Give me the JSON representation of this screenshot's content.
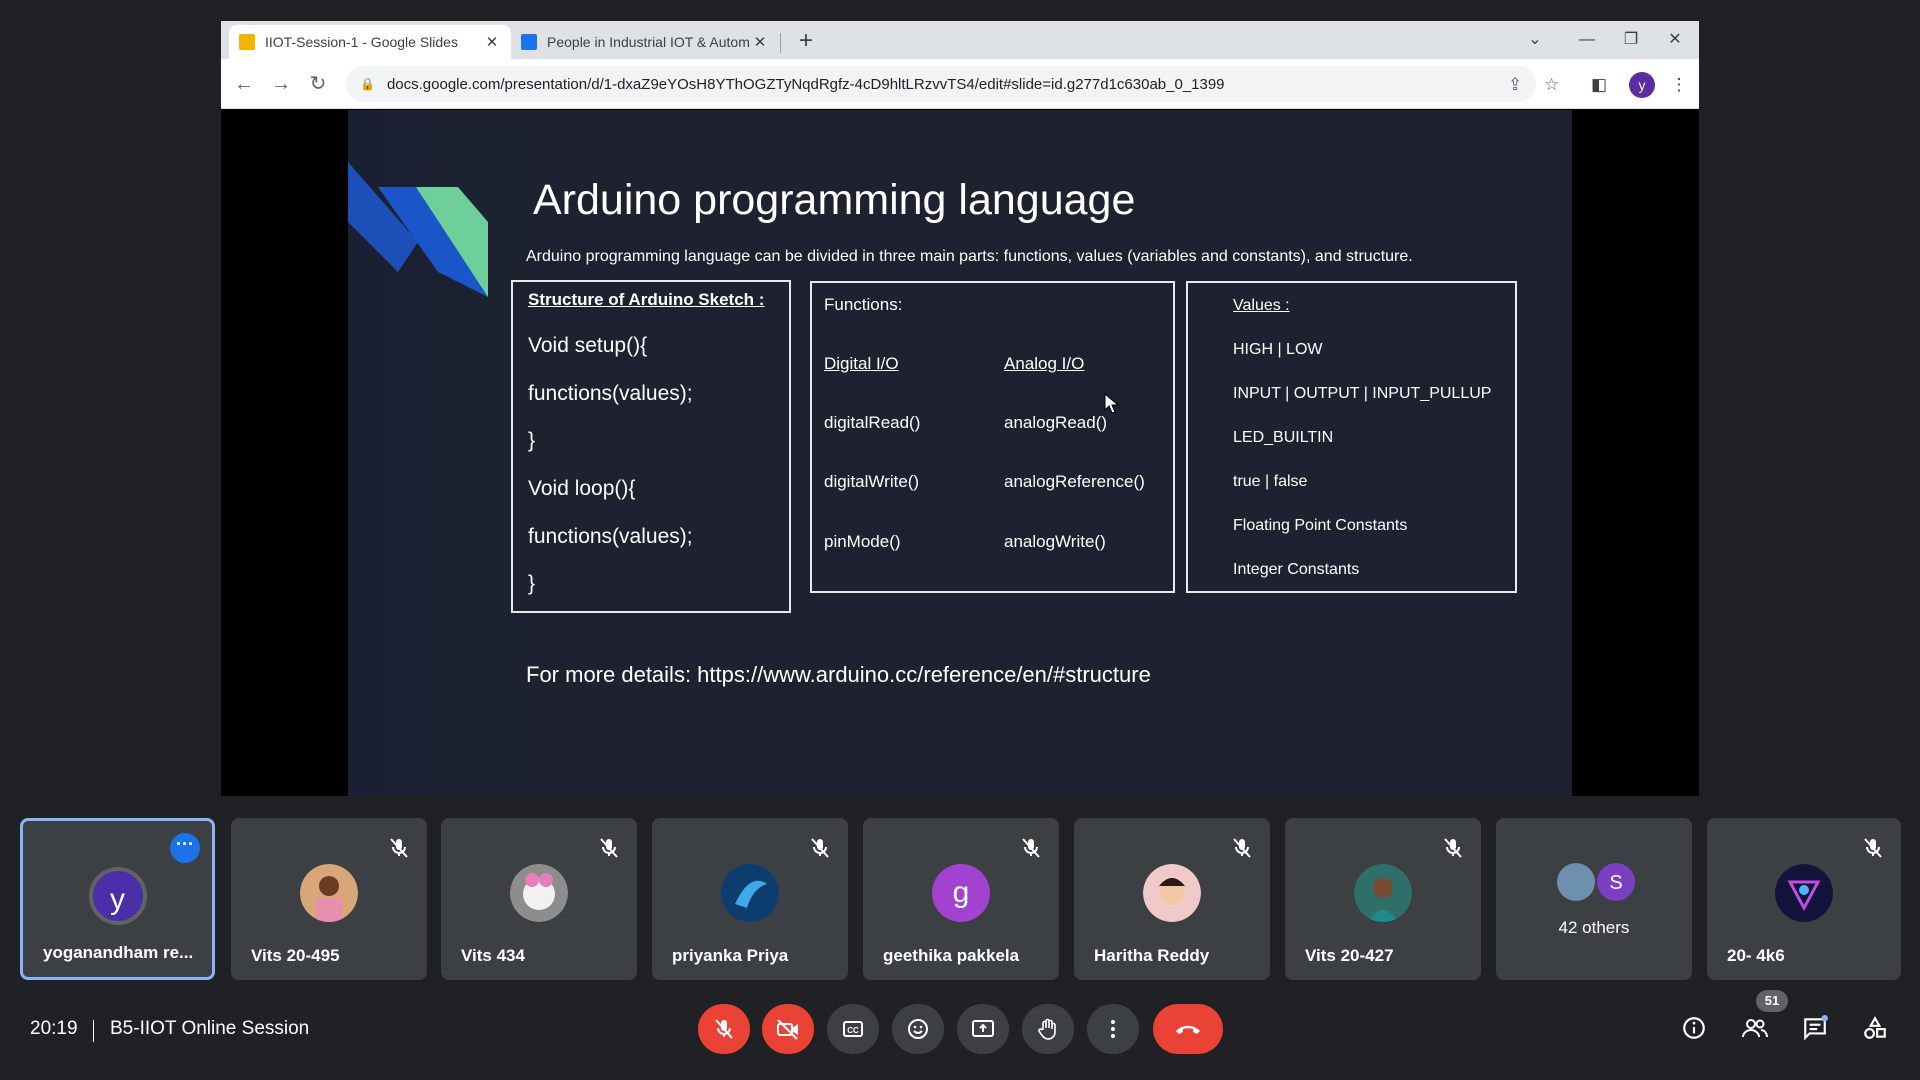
{
  "browser": {
    "tabs": [
      {
        "title": "IIOT-Session-1 - Google Slides",
        "active": true
      },
      {
        "title": "People in Industrial IOT & Autom",
        "active": false
      }
    ],
    "url": "docs.google.com/presentation/d/1-dxaZ9eYOsH8YThOGZTyNqdRgfz-4cD9hltLRzvvTS4/edit#slide=id.g277d1c630ab_0_1399",
    "profile_initial": "y"
  },
  "slide": {
    "title": "Arduino programming language",
    "subtitle": "Arduino programming language can be divided in three main parts: functions, values (variables and constants), and structure.",
    "structure": {
      "heading": "Structure of Arduino Sketch :",
      "lines": [
        "Void setup(){",
        "functions(values);",
        "}",
        "Void loop(){",
        "functions(values);",
        "}"
      ]
    },
    "functions": {
      "heading": "Functions:",
      "digital_heading": "Digital I/O",
      "analog_heading": "Analog I/O",
      "digital": [
        "digitalRead()",
        "digitalWrite()",
        "pinMode()"
      ],
      "analog": [
        "analogRead()",
        "analogReference()",
        "analogWrite()"
      ]
    },
    "values": {
      "heading": "Values :",
      "items": [
        "HIGH | LOW",
        "INPUT | OUTPUT | INPUT_PULLUP",
        "LED_BUILTIN",
        "true | false",
        "Floating Point Constants",
        "Integer Constants"
      ]
    },
    "footer": "For more details: https://www.arduino.cc/reference/en/#structure"
  },
  "participants": [
    {
      "name": "yoganandham re...",
      "initial": "y",
      "color": "#4a2fa8"
    },
    {
      "name": "Vits 20-495"
    },
    {
      "name": "Vits 434"
    },
    {
      "name": "priyanka Priya"
    },
    {
      "name": "geethika pakkela",
      "initial": "g",
      "color": "#a142d0"
    },
    {
      "name": "Haritha Reddy"
    },
    {
      "name": "Vits 20-427"
    },
    {
      "name": "42 others",
      "initial": "S",
      "color": "#7b3fc4"
    },
    {
      "name": "20- 4k6"
    }
  ],
  "meeting": {
    "time": "20:19",
    "title": "B5-IIOT Online Session",
    "participant_count": "51"
  },
  "colors": {
    "end_call": "#ea4335",
    "active_border": "#8ab4f8",
    "slide_bg": "#1e2230"
  }
}
